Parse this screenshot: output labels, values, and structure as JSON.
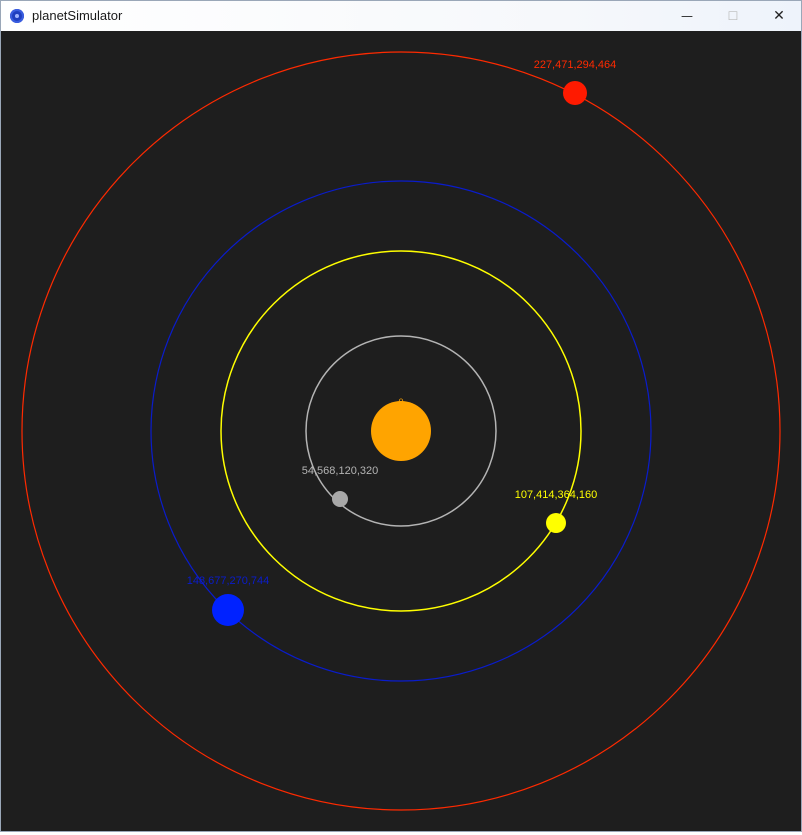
{
  "window": {
    "title": "planetSimulator",
    "controls": {
      "minimize": "—",
      "maximize": "☐",
      "close": "✕"
    }
  },
  "colors": {
    "background": "#1e1e1e",
    "sun": "#ffa400",
    "gray_planet": "#b4b4b4",
    "yellow_planet": "#ffff00",
    "blue_planet": "#0022ff",
    "red_planet": "#ff1a00"
  },
  "bodies": {
    "sun": {
      "label": "0"
    },
    "gray": {
      "label": "54,568,120,320"
    },
    "yellow": {
      "label": "107,414,364,160"
    },
    "blue": {
      "label": "148,677,270,744"
    },
    "red": {
      "label": "227,471,294,464"
    }
  }
}
